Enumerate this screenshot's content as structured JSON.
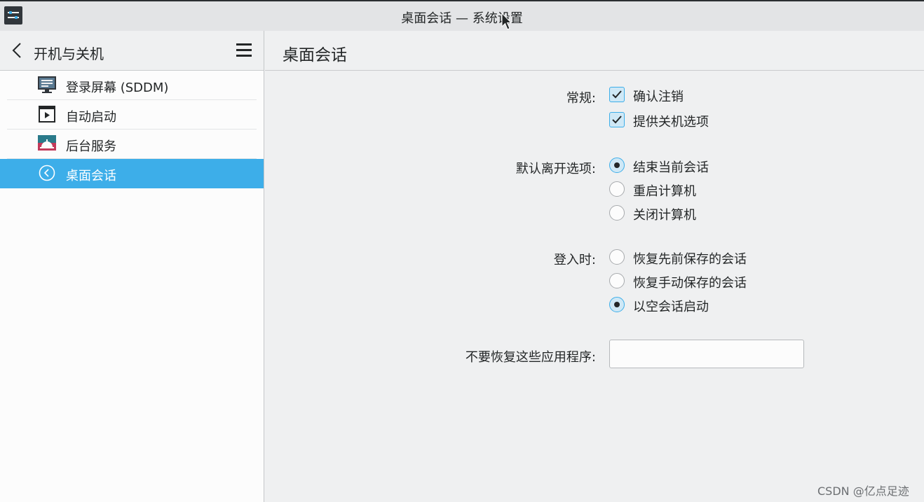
{
  "window": {
    "title": "桌面会话 — 系统设置",
    "app_icon": "settings-sliders-icon"
  },
  "sidebar": {
    "back_icon": "chevron-left-icon",
    "title": "开机与关机",
    "menu_icon": "hamburger-menu-icon",
    "items": [
      {
        "label": "登录屏幕 (SDDM)",
        "icon": "monitor-icon",
        "selected": false
      },
      {
        "label": "自动启动",
        "icon": "play-window-icon",
        "selected": false
      },
      {
        "label": "后台服务",
        "icon": "service-bell-icon",
        "selected": false
      },
      {
        "label": "桌面会话",
        "icon": "circle-chevron-left-icon",
        "selected": true
      }
    ]
  },
  "main": {
    "title": "桌面会话",
    "general": {
      "label": "常规:",
      "options": [
        {
          "label": "确认注销",
          "checked": true
        },
        {
          "label": "提供关机选项",
          "checked": true
        }
      ]
    },
    "default_leave": {
      "label": "默认离开选项:",
      "options": [
        {
          "label": "结束当前会话",
          "checked": true
        },
        {
          "label": "重启计算机",
          "checked": false
        },
        {
          "label": "关闭计算机",
          "checked": false
        }
      ]
    },
    "on_login": {
      "label": "登入时:",
      "options": [
        {
          "label": "恢复先前保存的会话",
          "checked": false
        },
        {
          "label": "恢复手动保存的会话",
          "checked": false
        },
        {
          "label": "以空会话启动",
          "checked": true
        }
      ]
    },
    "exclude_apps": {
      "label": "不要恢复这些应用程序:",
      "value": "",
      "placeholder": ""
    }
  },
  "watermark": "CSDN @亿点足迹",
  "colors": {
    "accent": "#3daee9",
    "text": "#232627",
    "background": "#eff0f1"
  }
}
